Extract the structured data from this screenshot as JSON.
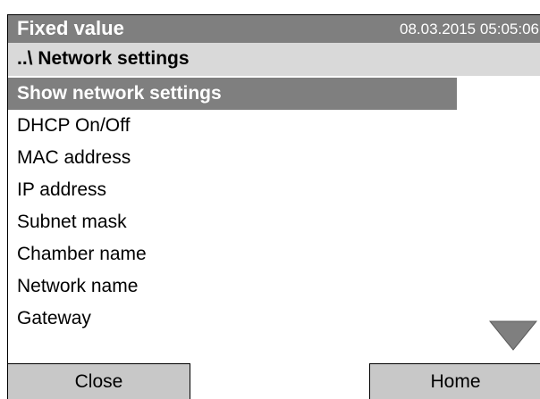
{
  "header": {
    "title": "Fixed value",
    "datetime": "08.03.2015  05:05:06"
  },
  "path": "..\\ Network settings",
  "menu": {
    "items": [
      {
        "label": "Show network settings",
        "selected": true
      },
      {
        "label": "DHCP On/Off"
      },
      {
        "label": "MAC address"
      },
      {
        "label": "IP address"
      },
      {
        "label": "Subnet mask"
      },
      {
        "label": "Chamber name"
      },
      {
        "label": "Network name"
      },
      {
        "label": "Gateway"
      }
    ]
  },
  "footer": {
    "close_label": "Close",
    "home_label": "Home"
  },
  "icons": {
    "scroll_down": "triangle-down-icon"
  },
  "colors": {
    "header_bg": "#7f7f7f",
    "path_bg": "#d9d9d9",
    "selected_bg": "#7f7f7f",
    "button_bg": "#c8c8c8"
  }
}
